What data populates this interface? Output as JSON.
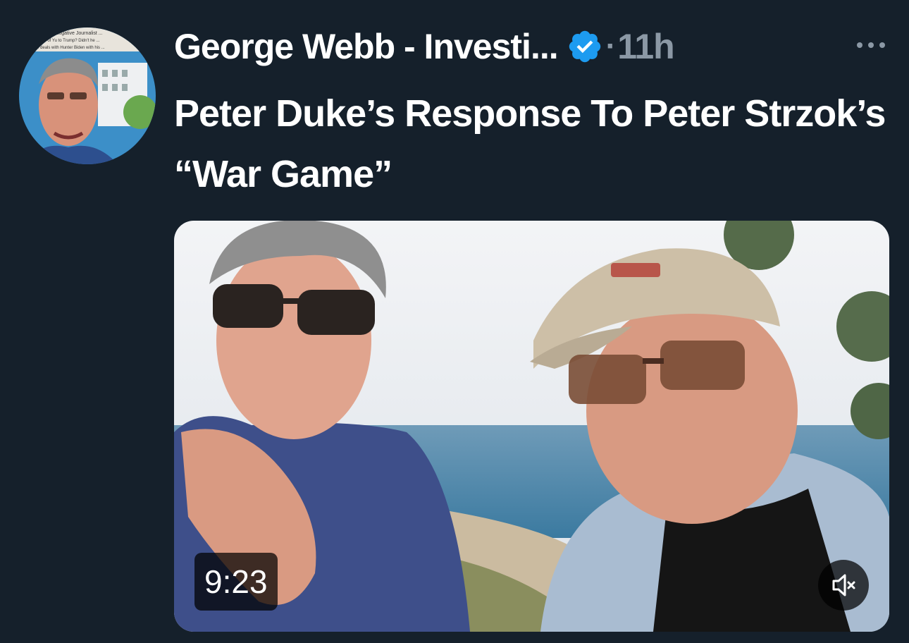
{
  "tweet": {
    "author_name": "George Webb - Investi...",
    "time_separator": "·",
    "timestamp": "11h",
    "text": "Peter Duke’s Response To Peter Strzok’s “War Game”",
    "more_icon": "more-horizontal-icon",
    "verified_icon": "verified-badge-icon"
  },
  "avatar": {
    "caption_line1": "Investigative Journalist ...",
    "caption_line2": "...ame of Yu to Trump? Didn't he ...",
    "caption_line3": "...hone deals with Hunter Biden with his ..."
  },
  "video": {
    "duration": "9:23",
    "mute_icon": "volume-muted-icon"
  },
  "colors": {
    "background": "#15202b",
    "text_primary": "#ffffff",
    "text_secondary": "#8b98a5",
    "verified_blue": "#1d9bf0"
  }
}
